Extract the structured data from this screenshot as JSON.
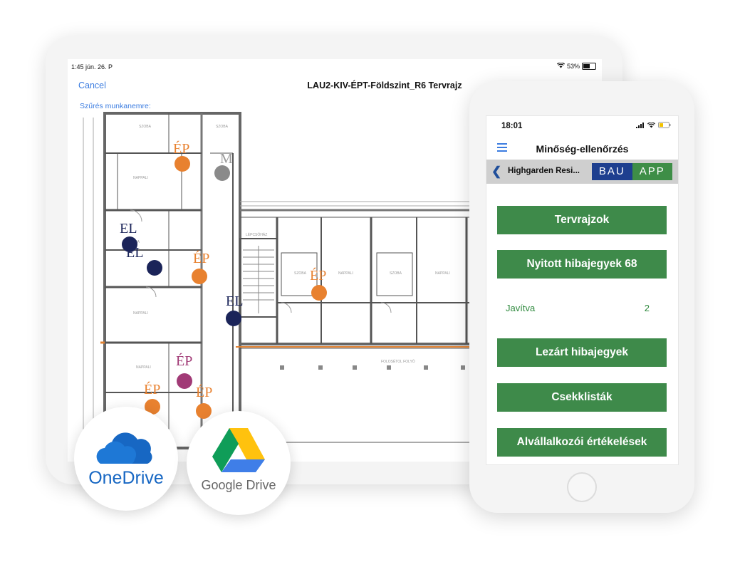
{
  "tablet": {
    "status": {
      "time": "1:45  jún. 26. P",
      "battery": "53%",
      "battery_level": 0.53
    },
    "nav": {
      "cancel_label": "Cancel",
      "title": "LAU2-KIV-ÉPT-Földszint_R6 Tervrajz"
    },
    "filter_label": "Szűrés munkanemre:",
    "markers": [
      {
        "label": "ÉP",
        "color": "#e8812f"
      },
      {
        "label": "M",
        "color": "#8a8a8a"
      },
      {
        "label": "EL",
        "color": "#1b2459"
      },
      {
        "label": "EL",
        "color": "#1b2459"
      },
      {
        "label": "ÉP",
        "color": "#e8812f"
      },
      {
        "label": "ÉP",
        "color": "#e8812f"
      },
      {
        "label": "EL",
        "color": "#1b2459"
      },
      {
        "label": "ÉP",
        "color": "#a13a76"
      },
      {
        "label": "ÉP",
        "color": "#e8812f"
      },
      {
        "label": "ÉP",
        "color": "#e8812f"
      }
    ]
  },
  "integrations": {
    "onedrive": {
      "label": "OneDrive",
      "color": "#1767c3"
    },
    "google_drive": {
      "label": "Google Drive"
    }
  },
  "phone": {
    "status": {
      "time": "18:01"
    },
    "header": {
      "title": "Minőség-ellenőrzés"
    },
    "project": {
      "name": "Highgarden Resi...",
      "logo_left": "BAU",
      "logo_right": "APP"
    },
    "buttons": {
      "plans": "Tervrajzok",
      "open_tickets": "Nyitott hibajegyek  68",
      "closed_tickets": "Lezárt hibajegyek",
      "checklists": "Csekklisták",
      "subcontractor_reviews": "Alvállalkozói értékelések"
    },
    "fixed_row": {
      "label": "Javítva",
      "count": "2"
    },
    "accent": "#3e8a4a"
  }
}
